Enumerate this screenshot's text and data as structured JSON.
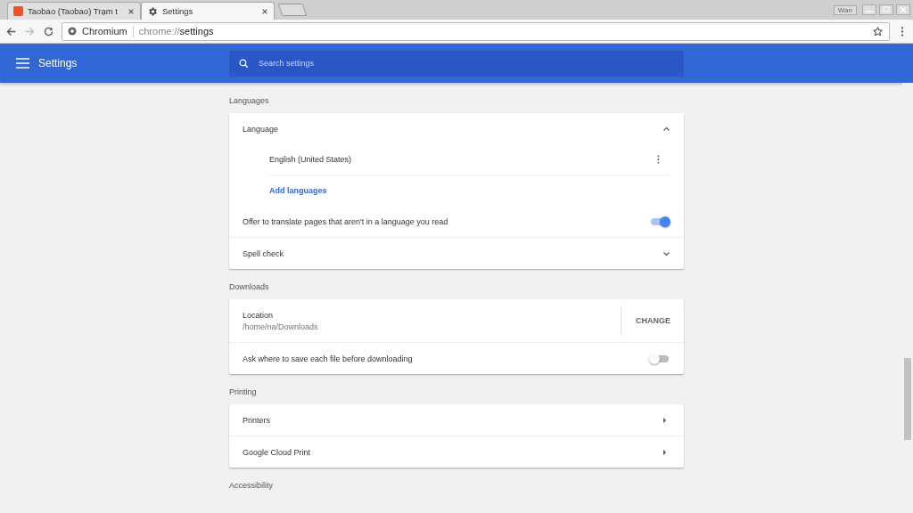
{
  "tabs": [
    {
      "title": "Taobao (Taobao) Trạm t",
      "selected": false
    },
    {
      "title": "Settings",
      "selected": true
    }
  ],
  "window": {
    "user": "Wan"
  },
  "address": {
    "site": "Chromium",
    "scheme": "chrome://",
    "path": "settings"
  },
  "header": {
    "title": "Settings",
    "search_placeholder": "Search settings"
  },
  "sections": [
    {
      "heading": "Languages",
      "rows": [
        {
          "kind": "expander",
          "label": "Language",
          "expanded": true,
          "children": [
            {
              "kind": "language",
              "label": "English (United States)"
            },
            {
              "kind": "link",
              "label": "Add languages"
            }
          ]
        },
        {
          "kind": "toggle",
          "label": "Offer to translate pages that aren't in a language you read",
          "on": true
        },
        {
          "kind": "expander",
          "label": "Spell check",
          "expanded": false
        }
      ]
    },
    {
      "heading": "Downloads",
      "rows": [
        {
          "kind": "location",
          "label": "Location",
          "value": "/home/na/Downloads",
          "button": "CHANGE"
        },
        {
          "kind": "toggle",
          "label": "Ask where to save each file before downloading",
          "on": false
        }
      ]
    },
    {
      "heading": "Printing",
      "rows": [
        {
          "kind": "nav",
          "label": "Printers"
        },
        {
          "kind": "nav",
          "label": "Google Cloud Print"
        }
      ]
    },
    {
      "heading": "Accessibility"
    }
  ]
}
